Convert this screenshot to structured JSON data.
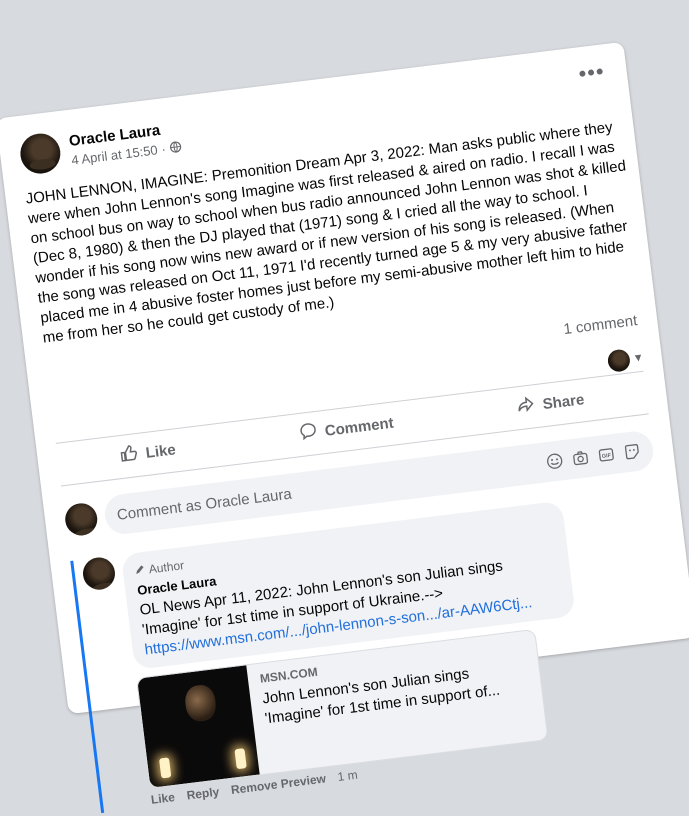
{
  "post": {
    "author": "Oracle Laura",
    "date": "4 April at 15:50",
    "separator": "·",
    "audience_icon": "globe-icon",
    "text": "JOHN LENNON, IMAGINE: Premonition Dream Apr 3, 2022: Man asks public where they were when John Lennon's song Imagine was first released & aired on radio. I recall I was on school bus on way to school when bus radio announced John Lennon was shot & killed (Dec 8, 1980) & then the DJ played that (1971) song & I cried all the way to school. I wonder if his song now wins new award or if new version of his song is released. (When the song was released on Oct 11, 1971 I'd recently turned age 5 & my very abusive father placed me in 4 abusive foster homes just before my semi-abusive mother left him to hide me from her so he could get custody of me.)",
    "comment_count": "1 comment",
    "more_label": "•••"
  },
  "actions": {
    "like": "Like",
    "comment": "Comment",
    "share": "Share"
  },
  "compose": {
    "placeholder": "Comment as Oracle Laura",
    "tools": [
      "smile-icon",
      "camera-icon",
      "gif-icon",
      "sticker-icon"
    ]
  },
  "reply": {
    "badge": "Author",
    "name": "Oracle Laura",
    "text": "OL News Apr 11, 2022: John Lennon's son Julian sings 'Imagine' for 1st time in support of Ukraine.-->",
    "link": "https://www.msn.com/.../john-lennon-s-son.../ar-AAW6Ctj...",
    "preview": {
      "source": "MSN.COM",
      "title": "John Lennon's son Julian sings 'Imagine' for 1st time in support of..."
    },
    "like": "Like",
    "reply": "Reply",
    "remove_preview": "Remove Preview",
    "time": "1 m"
  },
  "colors": {
    "accent": "#1877f2",
    "link": "#216fdb",
    "muted": "#65676b",
    "bubble": "#f0f2f5"
  }
}
